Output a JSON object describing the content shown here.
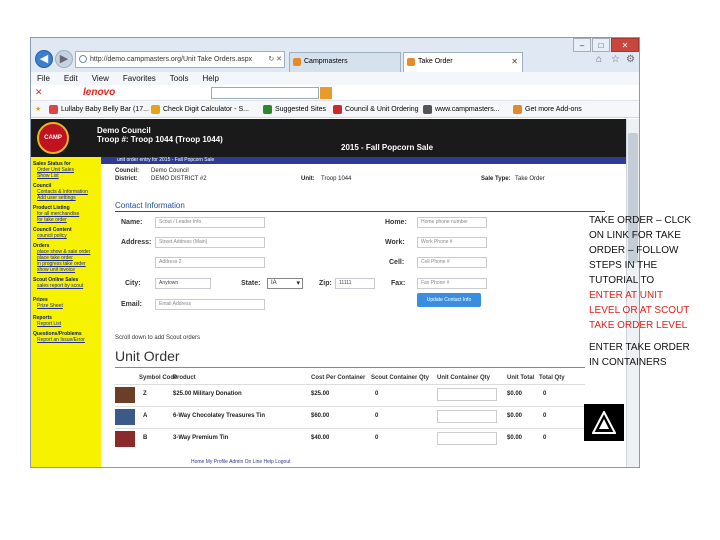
{
  "browser": {
    "address": "http://demo.campmasters.org/Unit Take Orders.aspx",
    "tabs": [
      {
        "label": "Campmasters"
      },
      {
        "label": "Take Order"
      }
    ],
    "menu": [
      "File",
      "Edit",
      "View",
      "Favorites",
      "Tools",
      "Help"
    ],
    "brand": "lenovo",
    "favorites": [
      "Lullaby Baby Belly Bar (17...",
      "Check Digit Calculator - S...",
      "Suggested Sites",
      "Council & Unit Ordering",
      "www.campmasters...",
      "Get more Add-ons"
    ]
  },
  "header": {
    "logo_text": "CAMP MASTERS",
    "council": "Demo Council",
    "troop": "Troop #: Troop 1044 (Troop 1044)",
    "sale": "2015 - Fall Popcorn Sale"
  },
  "sidebar": {
    "sections": [
      {
        "title": "Sales Status for",
        "items": [
          "Order Unit Sales",
          "Show List"
        ]
      },
      {
        "title": "Council",
        "items": [
          "Contacts & Information",
          "Add user settings"
        ]
      },
      {
        "title": "Product Listing",
        "items": [
          "for all merchandise",
          "for take order"
        ]
      },
      {
        "title": "Council Content",
        "items": [
          "council policy"
        ]
      },
      {
        "title": "Orders",
        "items": [
          "place show & sale order",
          "place take order",
          "in progress take order",
          "show unit invoice"
        ]
      },
      {
        "title": "Scout Online Sales",
        "items": [
          "sales report by scout"
        ]
      },
      {
        "title": "Prizes",
        "items": [
          "Prize Sheet"
        ]
      },
      {
        "title": "Reports",
        "items": [
          "Report List"
        ]
      },
      {
        "title": "Questions/Problems",
        "items": [
          "Report an Issue/Error"
        ]
      }
    ]
  },
  "order": {
    "banner": "unit order entry for 2015 - Fall Popcorn Sale",
    "council_label": "Council:",
    "council_value": "Demo Council",
    "district_label": "District:",
    "district_value": "DEMO DISTRICT #2",
    "unit_label": "Unit:",
    "unit_value": "Troop 1044",
    "saletype_label": "Sale Type:",
    "saletype_value": "Take Order"
  },
  "contact": {
    "heading": "Contact Information",
    "name_label": "Name:",
    "name_value": "Scout / Leader Info",
    "address_label": "Address:",
    "address_value": "Street Address (Main)",
    "address2_value": "Address 2",
    "city_label": "City:",
    "city_value": "Anytown",
    "state_label": "State:",
    "state_value": "IA",
    "zip_label": "Zip:",
    "zip_value": "11111",
    "email_label": "Email:",
    "email_value": "Email Address",
    "home_label": "Home:",
    "home_value": "Home phone number",
    "work_label": "Work:",
    "work_value": "Work Phone #",
    "cell_label": "Cell:",
    "cell_value": "Cell Phone #",
    "fax_label": "Fax:",
    "fax_value": "Fax Phone #",
    "update_button": "Update Contact Info"
  },
  "unit_order": {
    "scroll_note": "Scroll down to add Scout orders",
    "title": "Unit Order",
    "columns": [
      "Symbol Code",
      "Product",
      "Cost Per Container",
      "Scout Container Qty",
      "Unit Container Qty",
      "Unit Total",
      "Total Qty"
    ],
    "rows": [
      {
        "code": "Z",
        "product": "$25.00 Military Donation",
        "cost": "$25.00",
        "scout_qty": "0",
        "total": "$0.00",
        "total_qty": "0"
      },
      {
        "code": "A",
        "product": "6-Way Chocolatey Treasures Tin",
        "cost": "$60.00",
        "scout_qty": "0",
        "total": "$0.00",
        "total_qty": "0"
      },
      {
        "code": "B",
        "product": "3-Way Premium Tin",
        "cost": "$40.00",
        "scout_qty": "0",
        "total": "$0.00",
        "total_qty": "0"
      }
    ]
  },
  "footer": "Home  My Profile  Admin  On Line Help  Logout",
  "notes": {
    "black_lines": [
      "TAKE ORDER – CLCK",
      "ON LINK FOR TAKE",
      "ORDER – FOLLOW",
      "STEPS IN THE",
      "TUTORIAL TO"
    ],
    "red_lines": [
      "ENTER AT UNIT",
      "LEVEL OR AT SCOUT",
      "TAKE ORDER LEVEL"
    ],
    "bottom_lines": [
      "ENTER TAKE ORDER",
      "IN CONTAINERS"
    ],
    "red_color": "#e0201a"
  }
}
